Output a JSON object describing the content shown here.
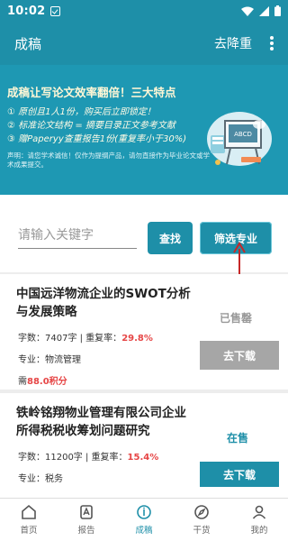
{
  "status_bar": {
    "time": "10:02"
  },
  "app_bar": {
    "title": "成稿",
    "action": "去降重"
  },
  "banner": {
    "headline": "成稿让写论文效率翻倍！三大特点",
    "features": [
      "① 原创且1人1份，购买后立即锁定！",
      "② 标准论文结构 = 摘要目录正文参考文献",
      "③ 赠Paperyy查重报告1份(重复率小于30%)"
    ],
    "disclaimer": "声明：请您学术诚信！仅作为提纲产品，请勿直接作为毕业论文或学术成果提交。",
    "illustration_text": "ABCD"
  },
  "search": {
    "placeholder": "请输入关键字",
    "search_label": "查找",
    "filter_label": "筛选专业"
  },
  "papers": [
    {
      "title": "中国远洋物流企业的SWOT分析与发展策略",
      "word_count_label": "字数：7407字 | 重复率：",
      "repeat_rate": "29.8%",
      "domain_label": "专业：物流管理",
      "points_prefix": "需",
      "points": "88.0积分",
      "status": "已售罄",
      "download_label": "去下载"
    },
    {
      "title": "铁岭铭翔物业管理有限公司企业所得税税收筹划问题研究",
      "word_count_label": "字数：11200字 | 重复率：",
      "repeat_rate": "15.4%",
      "domain_label": "专业：税务",
      "status": "在售",
      "download_label": "去下载"
    }
  ],
  "bottom_nav": [
    {
      "label": "首页",
      "icon": "home-icon"
    },
    {
      "label": "报告",
      "icon": "report-icon"
    },
    {
      "label": "成稿",
      "icon": "draft-icon",
      "active": true
    },
    {
      "label": "干货",
      "icon": "compass-icon"
    },
    {
      "label": "我的",
      "icon": "user-icon"
    }
  ],
  "colors": {
    "primary": "#1e8fa8",
    "banner": "#1e98b3",
    "accent_red": "#e64545"
  }
}
